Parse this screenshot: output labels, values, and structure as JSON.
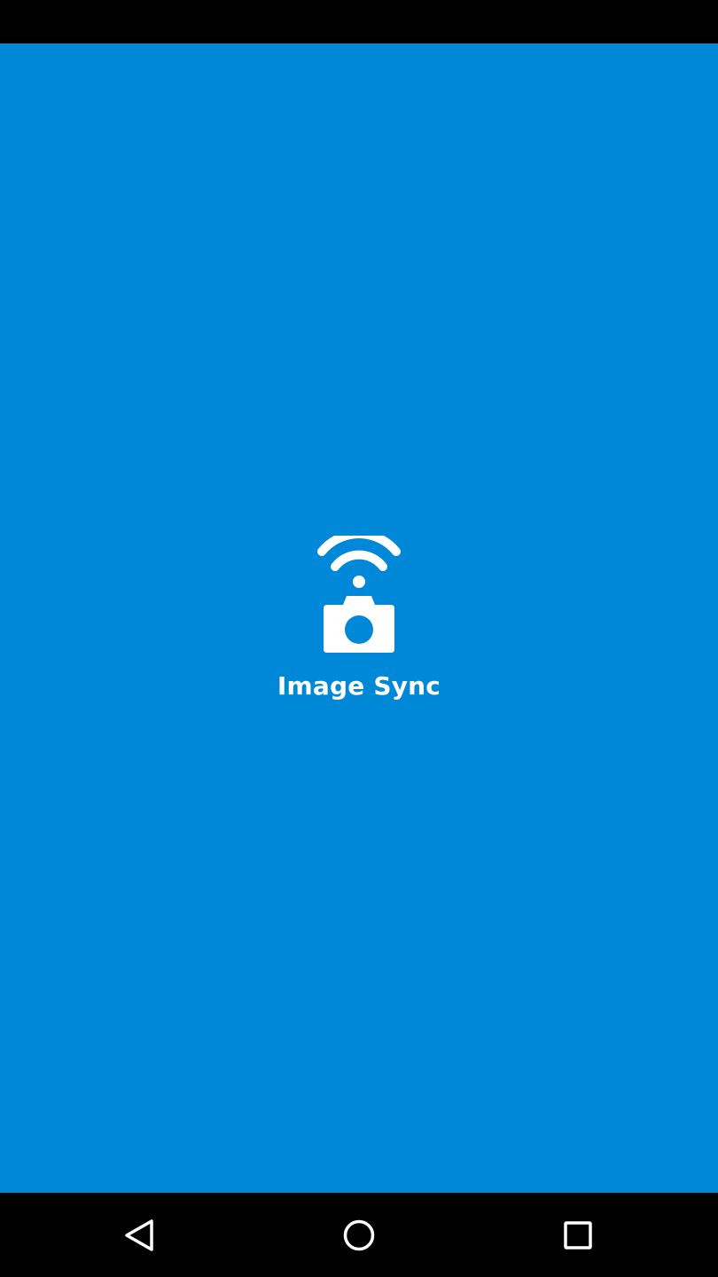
{
  "app": {
    "name": "Image Sync",
    "logo_icon": "wifi-camera-icon"
  },
  "colors": {
    "background": "#0088D8",
    "foreground": "#FFFFFF",
    "system_bars": "#000000"
  },
  "navigation": {
    "back_icon": "back-triangle-icon",
    "home_icon": "home-circle-icon",
    "recents_icon": "recents-square-icon"
  }
}
